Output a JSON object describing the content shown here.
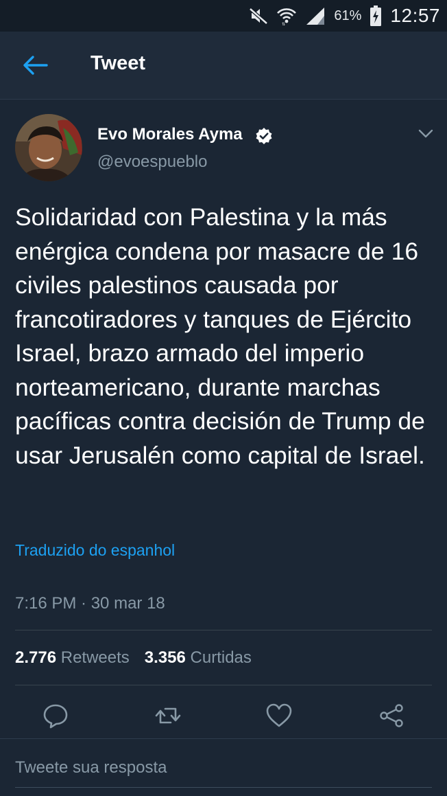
{
  "status_bar": {
    "battery_percent": "61%",
    "time": "12:57",
    "icons": [
      "mute-icon",
      "wifi-icon",
      "signal-icon",
      "battery-charging-icon"
    ]
  },
  "app_bar": {
    "back_icon": "back-arrow-icon",
    "title": "Tweet"
  },
  "tweet": {
    "author_name": "Evo Morales Ayma",
    "verified": true,
    "author_handle": "@evoespueblo",
    "text": "Solidaridad con Palestina y la más enérgica condena por masacre de 16 civiles palestinos causada por francotiradores y tanques de Ejército Israel, brazo armado del imperio norteamericano, durante marchas pacíficas contra decisión de Trump de usar Jerusalén como capital de Israel.",
    "translated_label": "Traduzido do espanhol",
    "timestamp": "7:16 PM · 30 mar 18",
    "retweets_count": "2.776",
    "retweets_label": "Retweets",
    "likes_count": "3.356",
    "likes_label": "Curtidas"
  },
  "actions": [
    "reply-icon",
    "retweet-icon",
    "like-icon",
    "share-icon"
  ],
  "reply": {
    "placeholder": "Tweete sua resposta"
  },
  "colors": {
    "background": "#1b2634",
    "app_bar": "#1f2b3a",
    "accent": "#1da1f2",
    "secondary_text": "#8899a6"
  }
}
